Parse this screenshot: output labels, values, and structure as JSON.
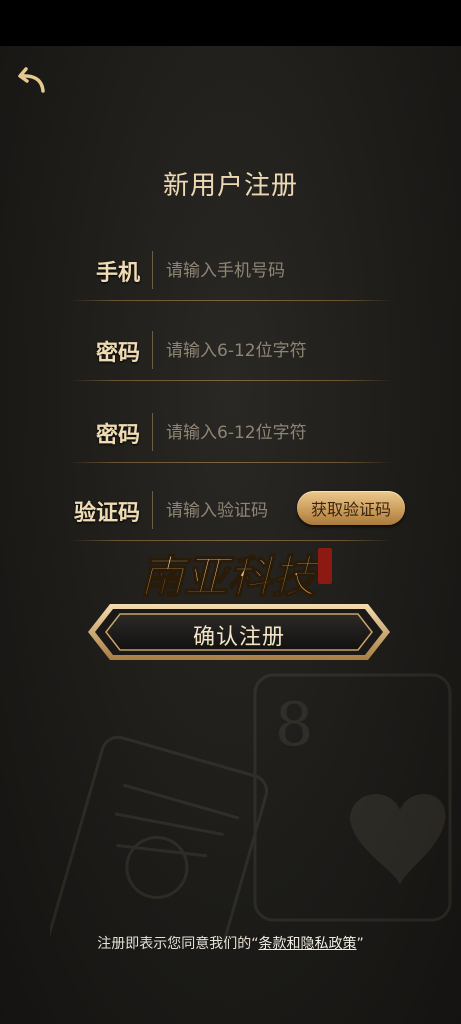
{
  "header": {
    "title": "新用户注册"
  },
  "form": {
    "phone": {
      "label": "手机",
      "placeholder": "请输入手机号码"
    },
    "password": {
      "label": "密码",
      "placeholder": "请输入6-12位字符"
    },
    "password_confirm": {
      "label": "密码",
      "placeholder": "请输入6-12位字符"
    },
    "code": {
      "label": "验证码",
      "placeholder": "请输入验证码",
      "button_label": "获取验证码"
    }
  },
  "brand": {
    "logo_text": "南亚科技"
  },
  "actions": {
    "confirm_label": "确认注册"
  },
  "footer": {
    "terms_prefix": "注册即表示您同意我们的",
    "terms_open_quote": "“",
    "terms_link": "条款和隐私政策",
    "terms_close_quote": "”"
  },
  "icons": {
    "back": "back-arrow-icon"
  },
  "colors": {
    "gold": "#c99a58",
    "text_gold": "#ecd9b3",
    "background": "#1b1a17"
  }
}
